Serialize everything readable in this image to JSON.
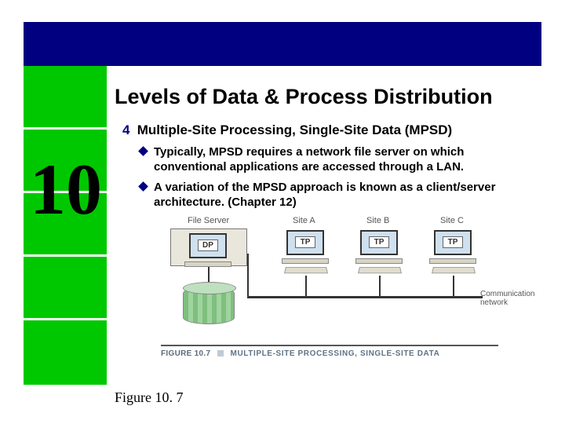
{
  "chapter_number": "10",
  "title": "Levels of Data & Process Distribution",
  "heading": "Multiple-Site Processing, Single-Site Data (MPSD)",
  "bullets": [
    "Typically, MPSD requires a network file server on which conventional applications are accessed through a LAN.",
    "A variation of the MPSD approach is known as a client/server architecture. (Chapter 12)"
  ],
  "diagram": {
    "file_server_label": "File Server",
    "file_server_badge": "DP",
    "sites": [
      {
        "label": "Site A",
        "badge": "TP"
      },
      {
        "label": "Site B",
        "badge": "TP"
      },
      {
        "label": "Site C",
        "badge": "TP"
      }
    ],
    "comm_label": "Communication\nnetwork",
    "caption_lead": "FIGURE 10.7",
    "caption_text": "MULTIPLE-SITE PROCESSING, SINGLE-SITE DATA"
  },
  "figure_ref": "Figure 10. 7"
}
